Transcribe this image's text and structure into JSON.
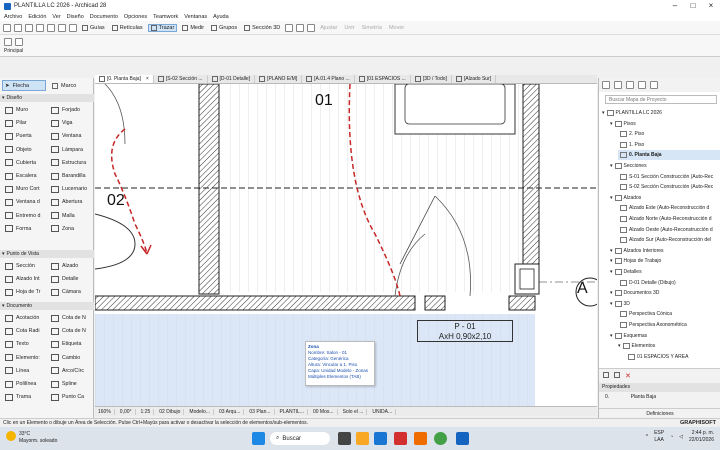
{
  "window": {
    "title": "PLANTILLA LC 2026 - Archicad 28"
  },
  "menu": [
    "Archivo",
    "Edición",
    "Ver",
    "Diseño",
    "Documento",
    "Opciones",
    "Teamwork",
    "Ventanas",
    "Ayuda"
  ],
  "toolbar": {
    "guias": "Guías",
    "reticulas": "Retículas",
    "trazar": "Trazar",
    "medir": "Medir",
    "grupos": "Grupos",
    "seccion3d": "Sección 3D",
    "ajustar": "Ajustar",
    "unir": "Unir",
    "simetria": "Simetría",
    "mover": "Mover"
  },
  "principal": "Principal",
  "toolbox": {
    "flecha": "Flecha",
    "marco": "Marco",
    "sections": [
      {
        "title": "Diseño",
        "tools": [
          "Muro",
          "Forjado",
          "Pilar",
          "Viga",
          "Puerta",
          "Ventana",
          "Objeto",
          "Lámpara",
          "Cubierta",
          "Estructura",
          "Escalera",
          "Barandilla",
          "Muro Cort",
          "Lucernario",
          "Ventana d",
          "Abertura",
          "Entremo d",
          "Malla",
          "Forma",
          "Zona"
        ]
      },
      {
        "title": "Punto de Vista",
        "tools": [
          "Sección",
          "Alzado",
          "Alzado Int",
          "Detalle",
          "Hoja de Tr",
          "Cámara"
        ]
      },
      {
        "title": "Documento",
        "tools": [
          "Acotación",
          "Cota de N",
          "Cota Radi",
          "Cota de N",
          "Texto",
          "Etiqueta",
          "Elemento:",
          "Cambio",
          "Línea",
          "Arco/Círc",
          "Polilínea",
          "Spline",
          "Trama",
          "Punto Ca"
        ]
      }
    ]
  },
  "tabs": [
    "[0. Planta Baja]",
    "[S-02 Sección ...",
    "[D-01 Detalle]",
    "[PLANO E/M]",
    "[A.01.4 Plano ...",
    "[01 ESPACIOS ...",
    "[3D / Todo]",
    "[Alzado Sur]"
  ],
  "canvas": {
    "room1": "01",
    "room2": "02",
    "marker": "A",
    "tag_line1": "P - 01",
    "tag_line2": "AxH  0,90x2,10"
  },
  "tooltip": {
    "title": "Zona",
    "lines": [
      "Nombre: Salon - 01",
      "Categoría: Genérica",
      "Altura: Vincular a 1. Piso",
      "Capa: Unidad Modelo - Zonas",
      "Múltiples Elementos (TAB)"
    ]
  },
  "viewbar": [
    "160%",
    "0,00°",
    "1:25",
    "02 Dibujo",
    "Modelo...",
    "03 Arqu...",
    "03 Plan...",
    "PLANTIL...",
    "00 Mos...",
    "Solo el ...",
    "UNIDA..."
  ],
  "navigator": {
    "search_placeholder": "Buscar Mapa de Proyecto",
    "tree": [
      {
        "label": "PLANTILLA LC 2026",
        "level": 0
      },
      {
        "label": "Pisos",
        "level": 1
      },
      {
        "label": "2. Piso",
        "level": 2
      },
      {
        "label": "1. Piso",
        "level": 2
      },
      {
        "label": "0. Planta Baja",
        "level": 2,
        "selected": true
      },
      {
        "label": "Secciones",
        "level": 1
      },
      {
        "label": "S-01 Sección Construcción (Auto-Rec",
        "level": 2
      },
      {
        "label": "S-02 Sección Construcción (Auto-Rec",
        "level": 2
      },
      {
        "label": "Alzados",
        "level": 1
      },
      {
        "label": "Alzado Este (Auto-Reconstrucción d",
        "level": 2
      },
      {
        "label": "Alzado Norte (Auto-Reconstrucción d",
        "level": 2
      },
      {
        "label": "Alzado Oeste (Auto-Reconstrucción d",
        "level": 2
      },
      {
        "label": "Alzado Sur (Auto-Reconstrucción del",
        "level": 2
      },
      {
        "label": "Alzados Interiores",
        "level": 1
      },
      {
        "label": "Hojas de Trabajo",
        "level": 1
      },
      {
        "label": "Detalles",
        "level": 1
      },
      {
        "label": "D-01 Detalle (Dibujo)",
        "level": 2
      },
      {
        "label": "Documentos 3D",
        "level": 1
      },
      {
        "label": "3D",
        "level": 1
      },
      {
        "label": "Perspectiva Cónica",
        "level": 2
      },
      {
        "label": "Perspectiva Axonométrica",
        "level": 2
      },
      {
        "label": "Esquemas",
        "level": 1
      },
      {
        "label": "Elementos",
        "level": 2
      },
      {
        "label": "01 ESPACIOS Y AREA",
        "level": 3
      }
    ],
    "props_title": "Propiedades",
    "props_id": "0.",
    "props_value": "Planta Baja",
    "definitions": "Definiciones"
  },
  "statusline": "Clic en un Elemento o dibuje un Área de Selección. Pulse Ctrl+Mayús para activar o desactivar la selección de elementos/sub-elementos.",
  "brand": "GRAPHISOFT",
  "taskbar": {
    "temp": "33°C",
    "weather": "Mayorm. soleado",
    "search": "Buscar",
    "lang1": "ESP",
    "lang2": "LAA",
    "time": "2:44 p. m.",
    "date": "22/01/2026"
  },
  "colors": {
    "accent": "#1565c0",
    "selection": "#cfe3f7",
    "zone_fill": "#dbe7f7",
    "dashed_red": "#c62828"
  }
}
